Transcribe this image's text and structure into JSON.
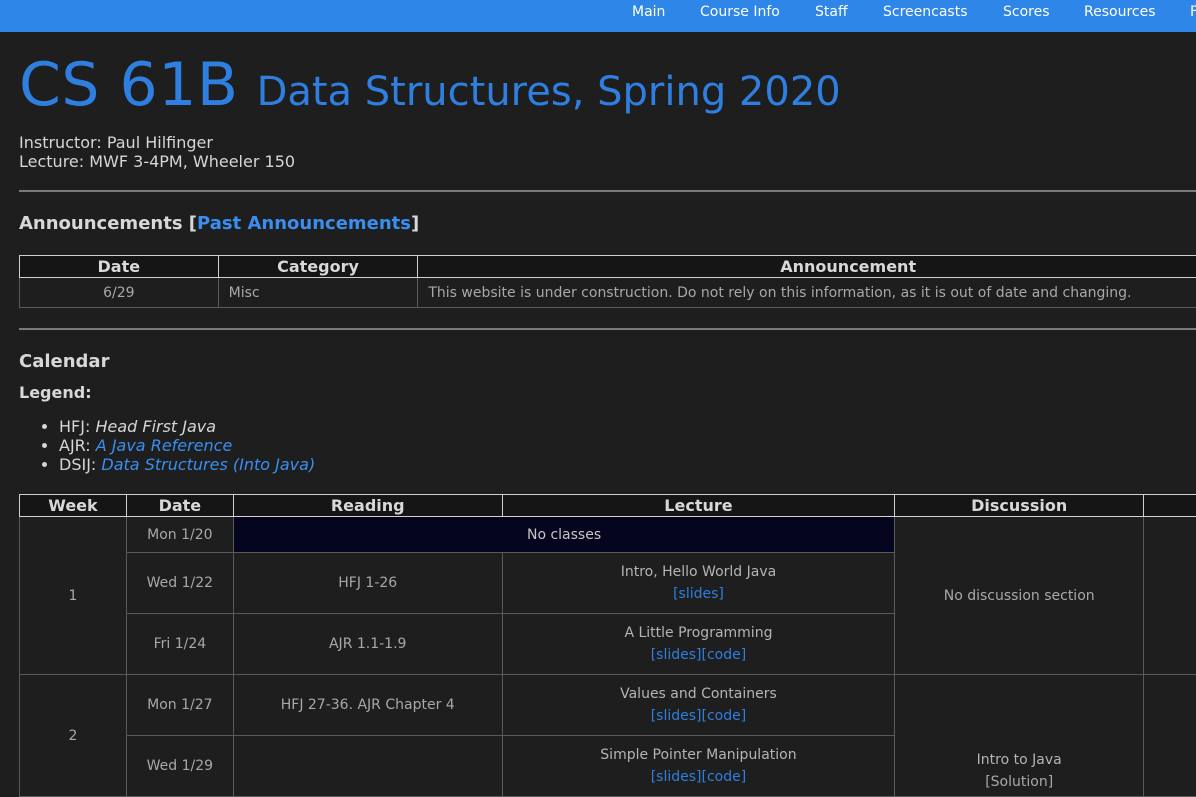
{
  "nav": [
    "Main",
    "Course Info",
    "Staff",
    "Screencasts",
    "Scores",
    "Resources",
    "F"
  ],
  "header": {
    "course": "CS 61B",
    "subtitle": "Data Structures, Spring 2020",
    "instructor": "Instructor: Paul Hilfinger",
    "lecture": "Lecture: MWF 3-4PM, Wheeler 150"
  },
  "announcements": {
    "heading_prefix": "Announcements [",
    "past_link": "Past Announcements",
    "heading_suffix": "]",
    "columns": [
      "Date",
      "Category",
      "Announcement"
    ],
    "rows": [
      {
        "date": "6/29",
        "category": "Misc",
        "text": "This website is under construction. Do not rely on this information, as it is out of date and changing."
      }
    ]
  },
  "calendar": {
    "heading": "Calendar",
    "legend_title": "Legend:",
    "legend": [
      {
        "abbr": "HFJ:",
        "title": "Head First Java",
        "link": false
      },
      {
        "abbr": "AJR:",
        "title": "A Java Reference",
        "link": true
      },
      {
        "abbr": "DSIJ:",
        "title": "Data Structures (Into Java)",
        "link": true
      }
    ],
    "columns": [
      "Week",
      "Date",
      "Reading",
      "Lecture",
      "Discussion"
    ],
    "weeks": [
      {
        "week": "1",
        "discussion": "No discussion section",
        "days": [
          {
            "date": "Mon 1/20",
            "no_classes": "No classes"
          },
          {
            "date": "Wed 1/22",
            "reading": "HFJ 1-26",
            "lecture": "Intro, Hello World Java",
            "links": [
              "[slides]"
            ]
          },
          {
            "date": "Fri 1/24",
            "reading": "AJR 1.1-1.9",
            "lecture": "A Little Programming",
            "links": [
              "[slides]",
              "[code]"
            ]
          }
        ]
      },
      {
        "week": "2",
        "discussion": "Intro to Java",
        "discussion_link": "[Solution]",
        "days": [
          {
            "date": "Mon 1/27",
            "reading": "HFJ 27-36. AJR Chapter 4",
            "lecture": "Values and Containers",
            "links": [
              "[slides]",
              "[code]"
            ]
          },
          {
            "date": "Wed 1/29",
            "reading": "",
            "lecture": "Simple Pointer Manipulation",
            "links": [
              "[slides]",
              "[code]"
            ]
          }
        ]
      }
    ]
  }
}
